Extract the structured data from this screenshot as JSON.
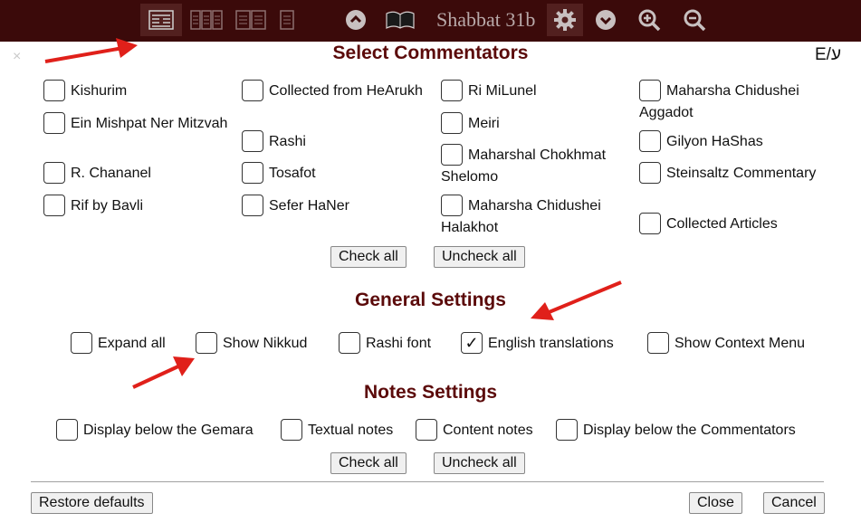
{
  "toolbar": {
    "title": "Shabbat 31b",
    "icons": [
      "layout-wide-icon",
      "layout-three-column-icon",
      "layout-two-column-icon",
      "layout-single-column-icon",
      "chevron-up-icon",
      "book-icon",
      "gear-icon",
      "chevron-down-icon",
      "zoom-in-icon",
      "zoom-out-icon"
    ]
  },
  "dialog": {
    "close_label": "×",
    "lang_toggle": "E/ע",
    "commentators": {
      "title": "Select Commentators",
      "items": [
        {
          "label": "Kishurim",
          "checked": false
        },
        {
          "label": "Ein Mishpat Ner Mitzvah",
          "checked": false
        },
        {
          "label": "R. Chananel",
          "checked": false
        },
        {
          "label": "Rif by Bavli",
          "checked": false
        },
        {
          "label": "Collected from HeArukh",
          "checked": false
        },
        {
          "label": "Rashi",
          "checked": false
        },
        {
          "label": "Tosafot",
          "checked": false
        },
        {
          "label": "Sefer HaNer",
          "checked": false
        },
        {
          "label": "Ri MiLunel",
          "checked": false
        },
        {
          "label": "Meiri",
          "checked": false
        },
        {
          "label": "Maharshal Chokhmat Shelomo",
          "checked": false
        },
        {
          "label": "Maharsha Chidushei Halakhot",
          "checked": false
        },
        {
          "label": "Maharsha Chidushei Aggadot",
          "checked": false
        },
        {
          "label": "Gilyon HaShas",
          "checked": false
        },
        {
          "label": "Steinsaltz Commentary",
          "checked": false
        },
        {
          "label": "Collected Articles",
          "checked": false
        }
      ],
      "check_all": "Check all",
      "uncheck_all": "Uncheck all"
    },
    "general": {
      "title": "General Settings",
      "items": [
        {
          "label": "Expand all",
          "checked": false
        },
        {
          "label": "Show Nikkud",
          "checked": false
        },
        {
          "label": "Rashi font",
          "checked": false
        },
        {
          "label": "English translations",
          "checked": true
        },
        {
          "label": "Show Context Menu",
          "checked": false
        }
      ]
    },
    "notes": {
      "title": "Notes Settings",
      "items": [
        {
          "label": "Display below the Gemara",
          "checked": false
        },
        {
          "label": "Textual notes",
          "checked": false
        },
        {
          "label": "Content notes",
          "checked": false
        },
        {
          "label": "Display below the Commentators",
          "checked": false
        }
      ],
      "check_all": "Check all",
      "uncheck_all": "Uncheck all"
    },
    "footer": {
      "restore": "Restore defaults",
      "close": "Close",
      "cancel": "Cancel"
    }
  },
  "colors": {
    "toolbar_bg": "#3b0a0a",
    "section_title": "#5b0a0a",
    "annotation_arrow": "#e0201a"
  }
}
